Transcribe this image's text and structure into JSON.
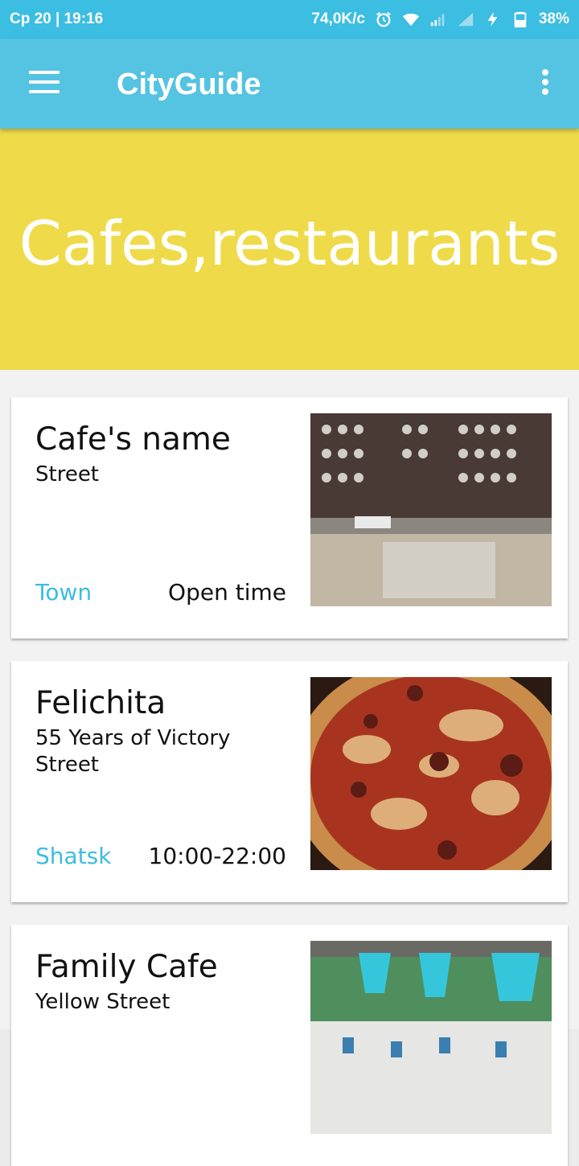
{
  "status_bar": {
    "left_text": "Ср 20 | 19:16",
    "speed": "74,0K/c",
    "battery": "38%"
  },
  "app_bar": {
    "title": "CityGuide"
  },
  "banner": {
    "title": "Cafes,restaurants"
  },
  "cafes": [
    {
      "name": "Cafe's name",
      "street": "Street",
      "town": "Town",
      "time": "Open time",
      "image": "cafe-interior-photo"
    },
    {
      "name": "Felichita",
      "street": "55 Years of Victory Street",
      "town": "Shatsk",
      "time": "10:00-22:00",
      "image": "pizza-photo"
    },
    {
      "name": "Family Cafe",
      "street": "Yellow Street",
      "town": "",
      "time": "",
      "image": "patio-photo"
    }
  ],
  "colors": {
    "status_bar": "#3cbde2",
    "app_bar": "#55c3e2",
    "banner": "#efdb4a",
    "town_link": "#3cbde2"
  }
}
